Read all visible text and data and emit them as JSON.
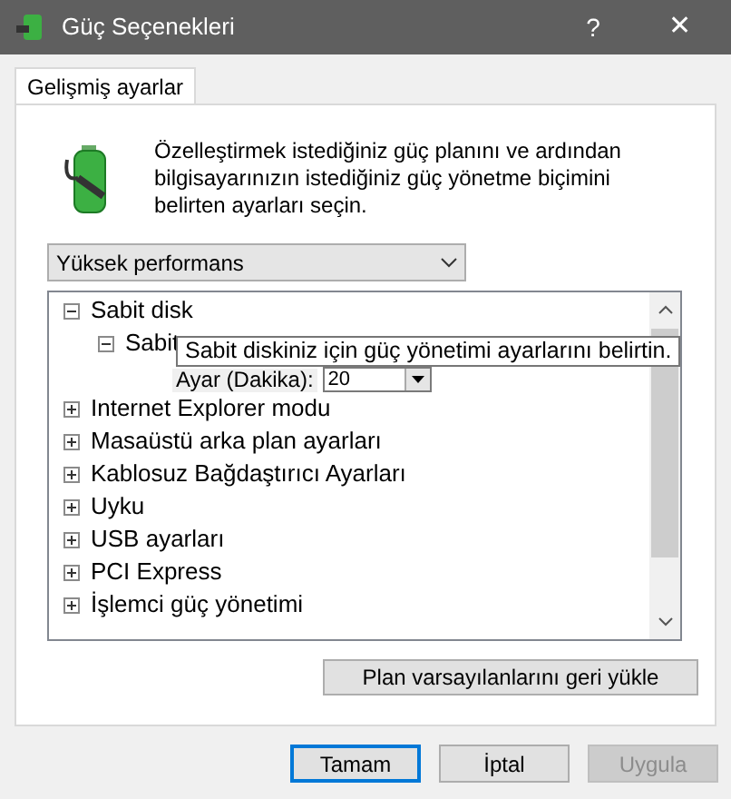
{
  "window": {
    "title": "Güç Seçenekleri",
    "help": "?",
    "close": "✕"
  },
  "tabs": [
    {
      "label": "Gelişmiş ayarlar",
      "selected": true
    }
  ],
  "description": "Özelleştirmek istediğiniz güç planını ve ardından bilgisayarınızın istediğiniz güç yönetme biçimini belirten ayarları seçin.",
  "plan_select": {
    "value": "Yüksek performans"
  },
  "tree": [
    {
      "label": "Sabit disk",
      "expanded": true,
      "children": [
        {
          "label": "Sabit",
          "expanded": true,
          "setting": {
            "label": "Ayar (Dakika):",
            "value": "20"
          }
        }
      ]
    },
    {
      "label": "Internet Explorer modu",
      "expanded": false
    },
    {
      "label": "Masaüstü arka plan ayarları",
      "expanded": false
    },
    {
      "label": "Kablosuz Bağdaştırıcı Ayarları",
      "expanded": false
    },
    {
      "label": "Uyku",
      "expanded": false
    },
    {
      "label": "USB ayarları",
      "expanded": false
    },
    {
      "label": "PCI Express",
      "expanded": false
    },
    {
      "label": "İşlemci güç yönetimi",
      "expanded": false
    }
  ],
  "tooltip": "Sabit diskiniz için güç yönetimi ayarlarını belirtin.",
  "restore_button": {
    "label": "Plan varsayılanlarını geri yükle"
  },
  "buttons": [
    {
      "label": "Tamam",
      "disabled": false,
      "selected": true
    },
    {
      "label": "İptal",
      "disabled": false,
      "selected": false
    },
    {
      "label": "Uygula",
      "disabled": true,
      "selected": false
    }
  ]
}
